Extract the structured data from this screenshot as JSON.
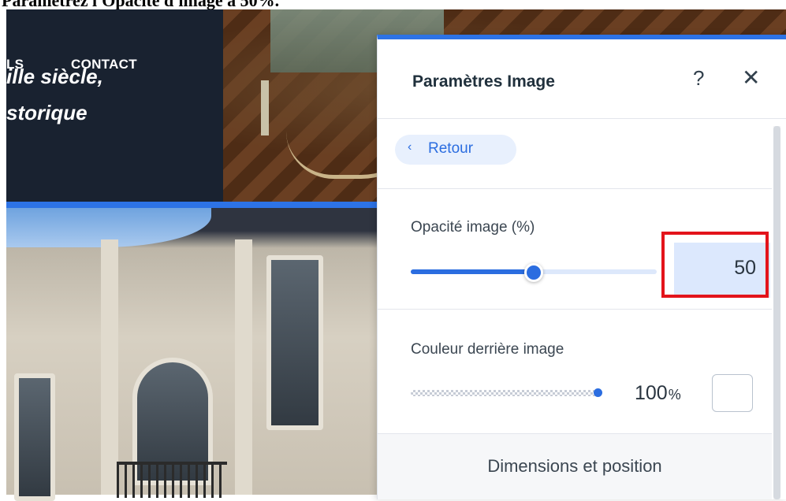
{
  "caption": "Paramétrez l'Opacité d'image à 50%.",
  "site": {
    "nav_partial": "LS",
    "nav_contact": "CONTACT",
    "headline_line1": "ille siècle,",
    "headline_line2": "storique"
  },
  "panel": {
    "title": "Paramètres Image",
    "help_icon": "?",
    "close_icon": "✕",
    "back_label": "Retour",
    "back_chevron": "‹",
    "opacity": {
      "label": "Opacité image (%)",
      "value": "50",
      "level": 0.5
    },
    "color": {
      "label": "Couleur derrière image",
      "percent": "100",
      "unit": "%",
      "level": 1.0,
      "swatch_color": "#ffffff"
    },
    "dimensions_label": "Dimensions et position"
  },
  "colors": {
    "accent": "#2d73e6",
    "highlight": "#e3141b",
    "site_dark": "#192230"
  }
}
